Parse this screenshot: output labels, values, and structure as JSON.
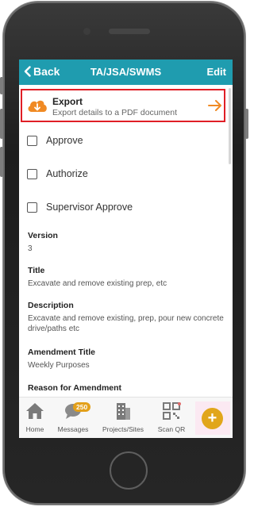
{
  "header": {
    "back_label": "Back",
    "title": "TA/JSA/SWMS",
    "edit_label": "Edit"
  },
  "export": {
    "title": "Export",
    "subtitle": "Export details to a PDF document"
  },
  "checkboxes": [
    {
      "label": "Approve",
      "checked": false
    },
    {
      "label": "Authorize",
      "checked": false
    },
    {
      "label": "Supervisor Approve",
      "checked": false
    }
  ],
  "fields": [
    {
      "label": "Version",
      "value": "3"
    },
    {
      "label": "Title",
      "value": "Excavate and remove existing prep, etc"
    },
    {
      "label": "Description",
      "value": "Excavate and remove existing, prep, pour new concrete drive/paths etc"
    },
    {
      "label": "Amendment Title",
      "value": "Weekly Purposes"
    },
    {
      "label": "Reason for Amendment",
      "value": ""
    }
  ],
  "tabbar": {
    "items": [
      {
        "label": "Home",
        "icon": "home-icon"
      },
      {
        "label": "Messages",
        "icon": "chat-icon",
        "badge": "250"
      },
      {
        "label": "Projects/Sites",
        "icon": "building-icon"
      },
      {
        "label": "Scan QR",
        "icon": "qr-icon"
      }
    ],
    "fab_symbol": "+"
  },
  "colors": {
    "header": "#1f9caf",
    "accent": "#e3a01a",
    "highlight_border": "#e01e26"
  }
}
